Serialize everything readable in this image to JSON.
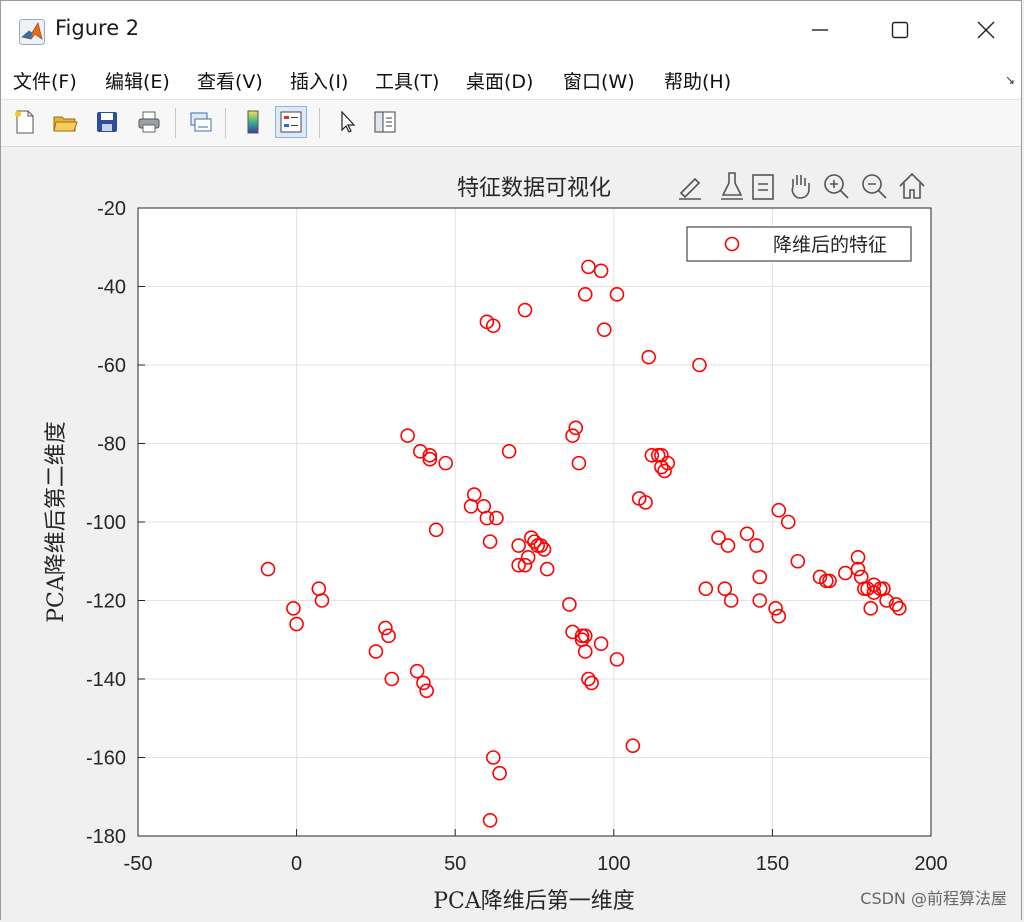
{
  "window": {
    "title": "Figure 2"
  },
  "menu": {
    "items": [
      "文件(F)",
      "编辑(E)",
      "查看(V)",
      "插入(I)",
      "工具(T)",
      "桌面(D)",
      "窗口(W)",
      "帮助(H)"
    ],
    "overflow": "↘"
  },
  "toolbar": {
    "buttons": [
      "new-figure-icon",
      "open-folder-icon",
      "save-icon",
      "print-icon",
      "link-plot-icon",
      "colorbar-icon",
      "legend-icon",
      "pointer-icon",
      "property-inspector-icon"
    ]
  },
  "axes_toolbar": {
    "icons": [
      "brush-icon",
      "data-tip-icon",
      "pan-icon",
      "zoom-in-icon",
      "zoom-out-icon",
      "home-icon"
    ]
  },
  "chart_data": {
    "type": "scatter",
    "title": "特征数据可视化",
    "xlabel": "PCA降维后第一维度",
    "ylabel": "PCA降维后第二维度",
    "xlim": [
      -50,
      200
    ],
    "ylim": [
      -180,
      -20
    ],
    "xticks": [
      -50,
      0,
      50,
      100,
      150,
      200
    ],
    "yticks": [
      -20,
      -40,
      -60,
      -80,
      -100,
      -120,
      -140,
      -160,
      -180
    ],
    "grid": true,
    "legend": {
      "position": "top-right",
      "entries": [
        "降维后的特征"
      ]
    },
    "series": [
      {
        "name": "降维后的特征",
        "color": "#ff0000",
        "marker": "circle",
        "points": [
          [
            -9,
            -112
          ],
          [
            -1,
            -122
          ],
          [
            0,
            -126
          ],
          [
            7,
            -117
          ],
          [
            8,
            -120
          ],
          [
            25,
            -133
          ],
          [
            28,
            -127
          ],
          [
            29,
            -129
          ],
          [
            30,
            -140
          ],
          [
            35,
            -78
          ],
          [
            38,
            -138
          ],
          [
            39,
            -82
          ],
          [
            40,
            -141
          ],
          [
            41,
            -143
          ],
          [
            42,
            -84
          ],
          [
            42,
            -83
          ],
          [
            44,
            -102
          ],
          [
            47,
            -85
          ],
          [
            55,
            -96
          ],
          [
            56,
            -93
          ],
          [
            59,
            -96
          ],
          [
            60,
            -49
          ],
          [
            60,
            -99
          ],
          [
            61,
            -105
          ],
          [
            61,
            -176
          ],
          [
            62,
            -50
          ],
          [
            62,
            -160
          ],
          [
            63,
            -99
          ],
          [
            64,
            -164
          ],
          [
            67,
            -82
          ],
          [
            70,
            -106
          ],
          [
            70,
            -111
          ],
          [
            72,
            -46
          ],
          [
            72,
            -111
          ],
          [
            73,
            -109
          ],
          [
            74,
            -104
          ],
          [
            75,
            -105
          ],
          [
            76,
            -106
          ],
          [
            77,
            -106
          ],
          [
            78,
            -107
          ],
          [
            79,
            -112
          ],
          [
            86,
            -121
          ],
          [
            87,
            -78
          ],
          [
            87,
            -128
          ],
          [
            88,
            -76
          ],
          [
            89,
            -85
          ],
          [
            90,
            -129
          ],
          [
            90,
            -130
          ],
          [
            91,
            -129
          ],
          [
            91,
            -133
          ],
          [
            91,
            -42
          ],
          [
            92,
            -35
          ],
          [
            92,
            -140
          ],
          [
            93,
            -141
          ],
          [
            96,
            -36
          ],
          [
            96,
            -131
          ],
          [
            97,
            -51
          ],
          [
            101,
            -42
          ],
          [
            101,
            -135
          ],
          [
            106,
            -157
          ],
          [
            108,
            -94
          ],
          [
            110,
            -95
          ],
          [
            111,
            -58
          ],
          [
            112,
            -83
          ],
          [
            114,
            -83
          ],
          [
            115,
            -86
          ],
          [
            115,
            -83
          ],
          [
            116,
            -87
          ],
          [
            117,
            -85
          ],
          [
            127,
            -60
          ],
          [
            129,
            -117
          ],
          [
            133,
            -104
          ],
          [
            135,
            -117
          ],
          [
            136,
            -106
          ],
          [
            137,
            -120
          ],
          [
            142,
            -103
          ],
          [
            145,
            -106
          ],
          [
            146,
            -120
          ],
          [
            146,
            -114
          ],
          [
            151,
            -122
          ],
          [
            152,
            -97
          ],
          [
            152,
            -124
          ],
          [
            155,
            -100
          ],
          [
            158,
            -110
          ],
          [
            165,
            -114
          ],
          [
            167,
            -115
          ],
          [
            168,
            -115
          ],
          [
            173,
            -113
          ],
          [
            177,
            -109
          ],
          [
            177,
            -112
          ],
          [
            178,
            -114
          ],
          [
            179,
            -117
          ],
          [
            180,
            -117
          ],
          [
            181,
            -122
          ],
          [
            182,
            -116
          ],
          [
            182,
            -118
          ],
          [
            184,
            -117
          ],
          [
            185,
            -117
          ],
          [
            186,
            -120
          ],
          [
            189,
            -121
          ],
          [
            190,
            -122
          ]
        ]
      }
    ]
  },
  "footer": {
    "watermark": "CSDN @前程算法屋"
  }
}
